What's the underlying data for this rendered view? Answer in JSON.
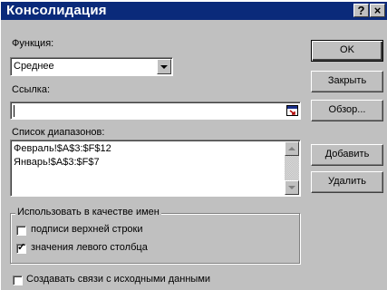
{
  "window": {
    "title": "Консолидация",
    "help_glyph": "?",
    "close_glyph": "×"
  },
  "function": {
    "label": "Функция:",
    "value": "Среднее"
  },
  "reference": {
    "label": "Ссылка:",
    "value": ""
  },
  "ranges": {
    "label": "Список диапазонов:",
    "items": [
      "Февраль!$A$3:$F$12",
      "Январь!$A$3:$F$7"
    ]
  },
  "buttons": {
    "ok": "OK",
    "close": "Закрыть",
    "browse": "Обзор...",
    "add": "Добавить",
    "delete": "Удалить"
  },
  "use_labels": {
    "title": "Использовать в качестве имен",
    "top_row": {
      "label": "подписи верхней строки",
      "checked": false
    },
    "left_column": {
      "label": "значения левого столбца",
      "checked": true
    }
  },
  "links": {
    "label": "Создавать связи с исходными данными",
    "checked": false
  },
  "colors": {
    "title_bar": "#0a2a7a",
    "dialog_bg": "#c0c0c0"
  }
}
